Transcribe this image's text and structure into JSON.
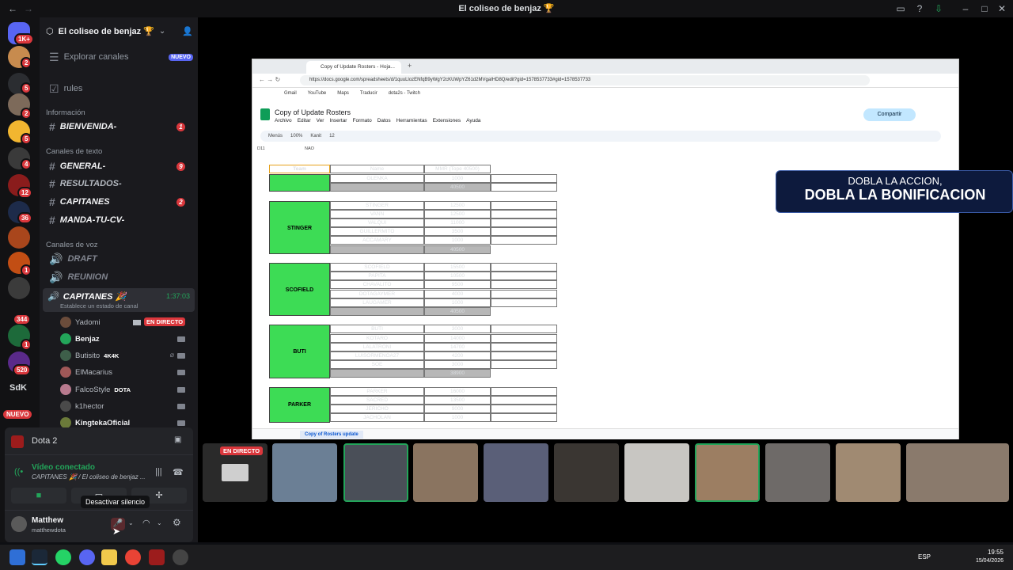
{
  "window": {
    "title": "El coliseo de benjaz 🏆"
  },
  "server": {
    "name": "El coliseo de benjaz 🏆"
  },
  "rail_badges": [
    "1K+",
    "2",
    "5",
    "2",
    "5",
    "4",
    "12",
    "36",
    "1",
    "344",
    "1",
    "520"
  ],
  "rail_sdk": "SdK",
  "rail_nuevo": "NUEVO",
  "sidebar": {
    "explore": "Explorar canales",
    "explore_badge": "NUEVO",
    "rules": "rules",
    "cat_info": "Información",
    "bienvenida": "BIENVENIDA-",
    "bienvenida_badge": "1",
    "cat_text": "Canales de texto",
    "general": "GENERAL-",
    "general_badge": "9",
    "resultados": "RESULTADOS-",
    "capitanes_t": "CAPITANES",
    "capitanes_badge": "2",
    "manda": "MANDA-TU-CV-",
    "cat_voice": "Canales de voz",
    "draft": "DRAFT",
    "reunion": "REUNION",
    "capitanes_v": "CAPITANES 🎉",
    "capitanes_time": "1:37:03",
    "status_hint": "Establece un estado de canal",
    "users": [
      {
        "name": "Yadomi",
        "tag": "EN DIRECTO"
      },
      {
        "name": "Benjaz",
        "tag": ""
      },
      {
        "name": "Butisito",
        "tag": "4K4K"
      },
      {
        "name": "ElMacarius",
        "tag": ""
      },
      {
        "name": "FalcoStyle",
        "tag": "DOTA"
      },
      {
        "name": "k1hector",
        "tag": ""
      },
      {
        "name": "KingtekaOficial",
        "tag": ""
      }
    ]
  },
  "activity": {
    "game": "Dota 2"
  },
  "voice": {
    "status": "Vídeo conectado",
    "channel": "CAPITANES 🎉 / El coliseo de benjaz ..."
  },
  "tooltip": "Desactivar silencio",
  "user": {
    "name": "Matthew",
    "handle": "matthewdota"
  },
  "browser": {
    "tab_title": "Copy of Update Rosters - Hoja...",
    "url": "https://docs.google.com/spreadsheets/d/1quuLlozENfqB9yWgY2cKUWpYZ61d2MVgaIHD8Q/edit?gid=1578537733#gid=1578537733",
    "bookmarks": [
      "Gmail",
      "YouTube",
      "Maps",
      "Traducir",
      "dota2s - Twitch"
    ],
    "doc_title": "Copy of Update Rosters",
    "menus": [
      "Archivo",
      "Editar",
      "Ver",
      "Insertar",
      "Formato",
      "Datos",
      "Herramientas",
      "Extensiones",
      "Ayuda"
    ],
    "share": "Compartir",
    "zoom": "100%",
    "font": "Kanit",
    "font_size": "12",
    "cell_ref": "D11",
    "formula": "NAO",
    "menus_label": "Menús",
    "sheet_tab": "Copy of Rosters update",
    "col_headers": [
      "Team",
      "Name",
      "MMR (Tope 40500)"
    ]
  },
  "sheet": {
    "top_rows": [
      {
        "row": "41",
        "name": "OLENKA",
        "mmr": "1000"
      },
      {
        "row": "42",
        "name": "",
        "mmr": "40500",
        "total": true
      }
    ],
    "teams": [
      {
        "team": "STINGER",
        "rows": [
          {
            "row": "44",
            "name": "STINGER",
            "mmr": "12500"
          },
          {
            "row": "45",
            "name": "VANN",
            "mmr": "12500"
          },
          {
            "row": "46",
            "name": "VALQUI",
            "mmr": "11000"
          },
          {
            "row": "47",
            "name": "GUILLERMITO",
            "mmr": "3500"
          },
          {
            "row": "48",
            "name": "ACCAMARY",
            "mmr": "1000"
          }
        ],
        "total": "40500"
      },
      {
        "team": "SCOFIELD",
        "rows": [
          {
            "row": "51",
            "name": "SCOFIELD",
            "mmr": "15500"
          },
          {
            "row": "52",
            "name": "PAPITA",
            "mmr": "10500"
          },
          {
            "row": "53",
            "name": "CHAVALITO",
            "mmr": "9500"
          },
          {
            "row": "54",
            "name": "DOTAGAYMER",
            "mmr": "4000"
          },
          {
            "row": "55",
            "name": "LAUGAMER",
            "mmr": "1000"
          }
        ],
        "total": "40500"
      },
      {
        "team": "BUTI",
        "rows": [
          {
            "row": "58",
            "name": "BUTI",
            "mmr": "3000"
          },
          {
            "row": "59",
            "name": "KOTARO",
            "mmr": "14000"
          },
          {
            "row": "60",
            "name": "LALATRONI",
            "mmr": "14700"
          },
          {
            "row": "61",
            "name": "LUISORMENOA27",
            "mmr": "4200"
          },
          {
            "row": "62",
            "name": "SOE",
            "mmr": "3000"
          }
        ],
        "total": "38900"
      },
      {
        "team": "PARKER",
        "rows": [
          {
            "row": "65",
            "name": "PARKER",
            "mmr": "16000"
          },
          {
            "row": "66",
            "name": "SACRED",
            "mmr": "13500"
          },
          {
            "row": "67",
            "name": "JERICHO",
            "mmr": "9000"
          },
          {
            "row": "68",
            "name": "JACHOLAN",
            "mmr": "1000"
          }
        ],
        "total": ""
      }
    ]
  },
  "overlay": {
    "line1": "DOBLA LA ACCION,",
    "line2": "DOBLA LA BONIFICACION"
  },
  "stream_label": "EN DIRECTO",
  "taskbar": {
    "lang": "ESP",
    "time": "19:55",
    "date": "15/04/2026"
  }
}
